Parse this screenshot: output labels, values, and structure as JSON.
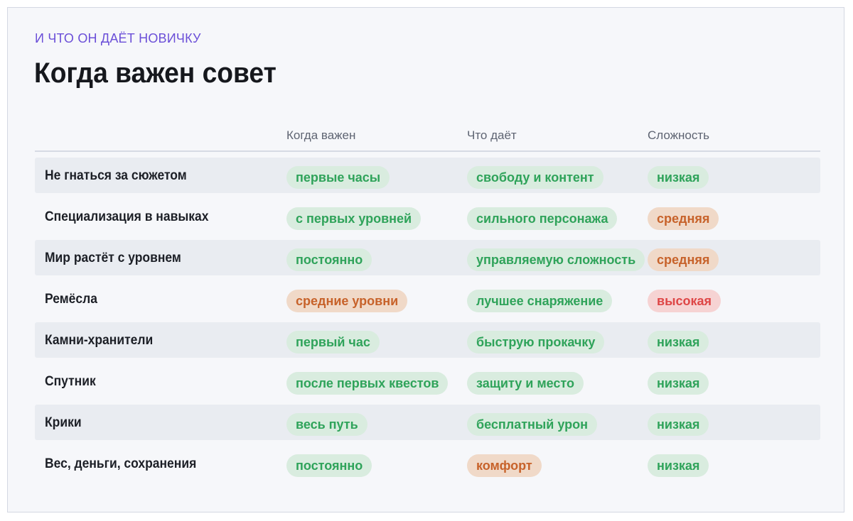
{
  "header": {
    "eyebrow": "И ЧТО ОН ДАЁТ НОВИЧКУ",
    "title": "Когда важен совет"
  },
  "columns": [
    "Когда важен",
    "Что даёт",
    "Сложность"
  ],
  "colors": {
    "green": "#2fa35a",
    "orange": "#c7622a",
    "red": "#de4646",
    "accent": "#6b4fd8"
  },
  "rows": [
    {
      "name": "Не гнаться за сюжетом",
      "when": "первые часы",
      "when_tone": "green",
      "gives": "свободу и контент",
      "gives_tone": "green",
      "difficulty": "низкая",
      "difficulty_tone": "green"
    },
    {
      "name": "Специализация в навыках",
      "when": "с первых уровней",
      "when_tone": "green",
      "gives": "сильного персонажа",
      "gives_tone": "green",
      "difficulty": "средняя",
      "difficulty_tone": "orange"
    },
    {
      "name": "Мир растёт с уровнем",
      "when": "постоянно",
      "when_tone": "green",
      "gives": "управляемую сложность",
      "gives_tone": "green",
      "difficulty": "средняя",
      "difficulty_tone": "orange"
    },
    {
      "name": "Ремёсла",
      "when": "средние уровни",
      "when_tone": "orange",
      "gives": "лучшее снаряжение",
      "gives_tone": "green",
      "difficulty": "высокая",
      "difficulty_tone": "red"
    },
    {
      "name": "Камни-хранители",
      "when": "первый час",
      "when_tone": "green",
      "gives": "быструю прокачку",
      "gives_tone": "green",
      "difficulty": "низкая",
      "difficulty_tone": "green"
    },
    {
      "name": "Спутник",
      "when": "после первых квестов",
      "when_tone": "green",
      "gives": "защиту и место",
      "gives_tone": "green",
      "difficulty": "низкая",
      "difficulty_tone": "green"
    },
    {
      "name": "Крики",
      "when": "весь путь",
      "when_tone": "green",
      "gives": "бесплатный урон",
      "gives_tone": "green",
      "difficulty": "низкая",
      "difficulty_tone": "green"
    },
    {
      "name": "Вес, деньги, сохранения",
      "when": "постоянно",
      "when_tone": "green",
      "gives": "комфорт",
      "gives_tone": "orange",
      "difficulty": "низкая",
      "difficulty_tone": "green"
    }
  ]
}
